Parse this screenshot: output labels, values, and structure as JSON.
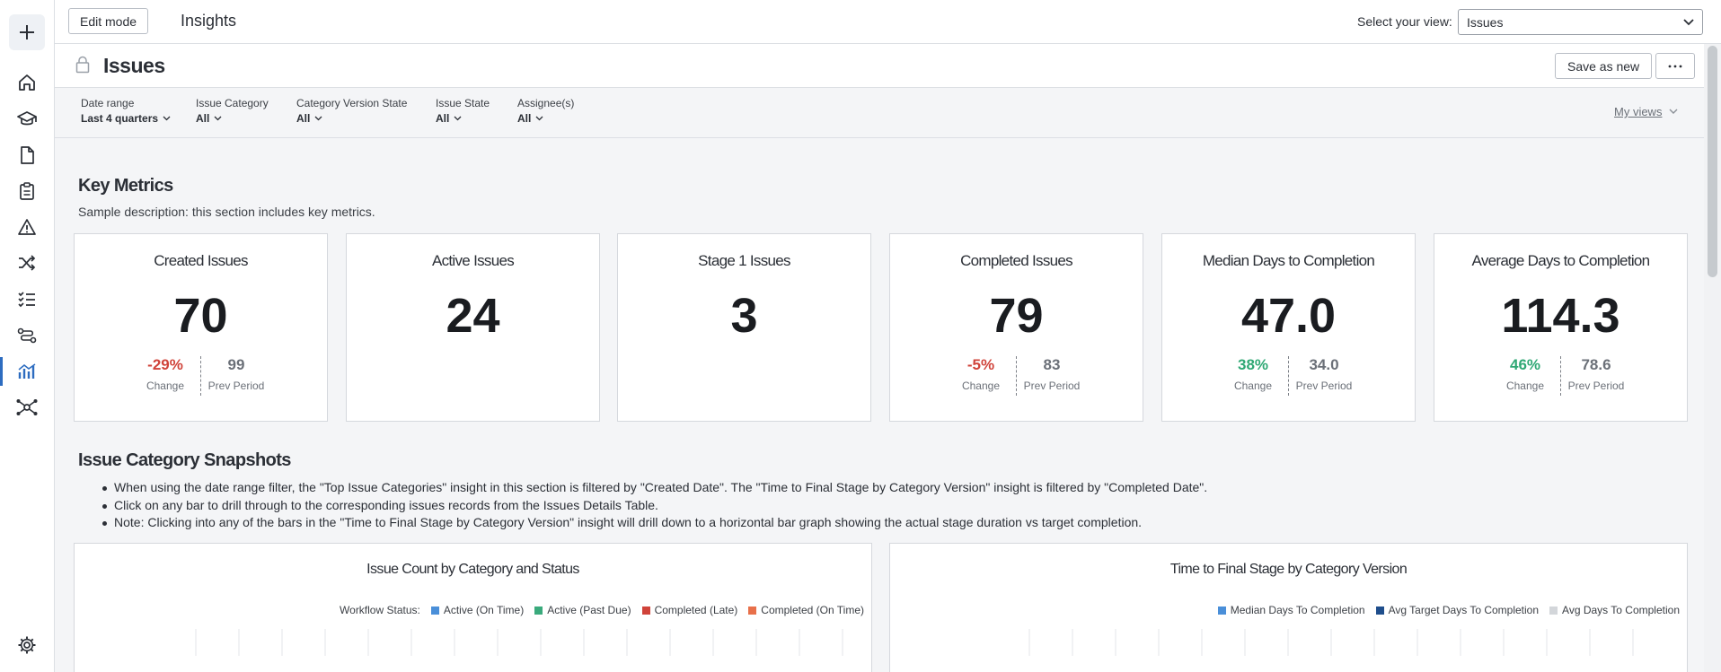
{
  "topbar": {
    "edit_label": "Edit mode",
    "app_title": "Insights",
    "view_label": "Select your view:",
    "view_value": "Issues"
  },
  "rail": {
    "icons": [
      "plus-icon",
      "home-icon",
      "graduation-cap-icon",
      "document-icon",
      "clipboard-icon",
      "warning-icon",
      "shuffle-icon",
      "checklist-icon",
      "workflow-icon",
      "chart-icon",
      "network-icon",
      "gear-icon"
    ],
    "active": "chart-icon",
    "accent": "#2d6cc0"
  },
  "page": {
    "title": "Issues",
    "save_label": "Save as new",
    "more_label": "···"
  },
  "filters": [
    {
      "label": "Date range",
      "value": "Last 4 quarters"
    },
    {
      "label": "Issue Category",
      "value": "All"
    },
    {
      "label": "Category Version State",
      "value": "All"
    },
    {
      "label": "Issue State",
      "value": "All"
    },
    {
      "label": "Assignee(s)",
      "value": "All"
    }
  ],
  "my_views_label": "My views",
  "key_metrics": {
    "title": "Key Metrics",
    "description": "Sample description: this section includes key metrics.",
    "cards": [
      {
        "title": "Created Issues",
        "value": "70",
        "change": "-29%",
        "change_label": "Change",
        "prev": "99",
        "prev_label": "Prev Period",
        "trend": "neg"
      },
      {
        "title": "Active Issues",
        "value": "24"
      },
      {
        "title": "Stage 1 Issues",
        "value": "3"
      },
      {
        "title": "Completed Issues",
        "value": "79",
        "change": "-5%",
        "change_label": "Change",
        "prev": "83",
        "prev_label": "Prev Period",
        "trend": "neg"
      },
      {
        "title": "Median Days to Completion",
        "value": "47.0",
        "change": "38%",
        "change_label": "Change",
        "prev": "34.0",
        "prev_label": "Prev Period",
        "trend": "pos"
      },
      {
        "title": "Average Days to Completion",
        "value": "114.3",
        "change": "46%",
        "change_label": "Change",
        "prev": "78.6",
        "prev_label": "Prev Period",
        "trend": "pos"
      }
    ]
  },
  "snapshots": {
    "title": "Issue Category Snapshots",
    "bullets": [
      "When using the date range filter, the \"Top Issue Categories\" insight in this section is filtered by \"Created Date\". The \"Time to Final Stage by Category Version\" insight is filtered by \"Completed Date\".",
      "Click on any bar to drill through to the corresponding issues records from the Issues Details Table.",
      "Note: Clicking into any of the bars in the \"Time to Final Stage by Category Version\" insight will drill down to a horizontal bar graph showing the actual stage duration vs target completion."
    ]
  },
  "chart_data": [
    {
      "type": "bar",
      "title": "Issue Count by Category and Status",
      "legend_title": "Workflow Status:",
      "legend_position": "top-right",
      "series": [
        {
          "name": "Active (On Time)",
          "color": "#4a8fd9"
        },
        {
          "name": "Active (Past Due)",
          "color": "#3aaa7c"
        },
        {
          "name": "Completed (Late)",
          "color": "#d0433a"
        },
        {
          "name": "Completed (On Time)",
          "color": "#e8704a"
        }
      ],
      "grid": true
    },
    {
      "type": "bar",
      "title": "Time to Final Stage by Category Version",
      "legend_position": "top-right",
      "series": [
        {
          "name": "Median Days To Completion",
          "color": "#4a8fd9"
        },
        {
          "name": "Avg Target Days To Completion",
          "color": "#1f4e8c"
        },
        {
          "name": "Avg Days To Completion",
          "color": "#d3d6da"
        }
      ],
      "grid": true
    }
  ]
}
